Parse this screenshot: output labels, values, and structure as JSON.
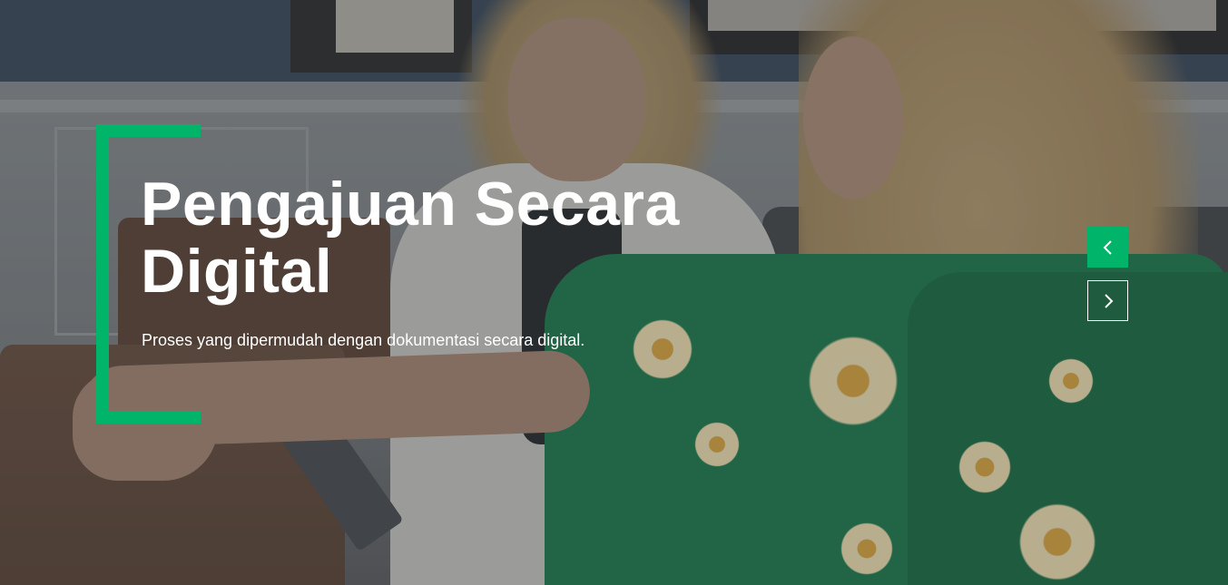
{
  "hero": {
    "title": "Pengajuan Secara Digital",
    "subtitle": "Proses yang dipermudah dengan dokumentasi secara digital."
  },
  "slider": {
    "prev_icon": "chevron-left-icon",
    "next_icon": "chevron-right-icon"
  },
  "colors": {
    "accent": "#00b46a",
    "text": "#ffffff"
  }
}
